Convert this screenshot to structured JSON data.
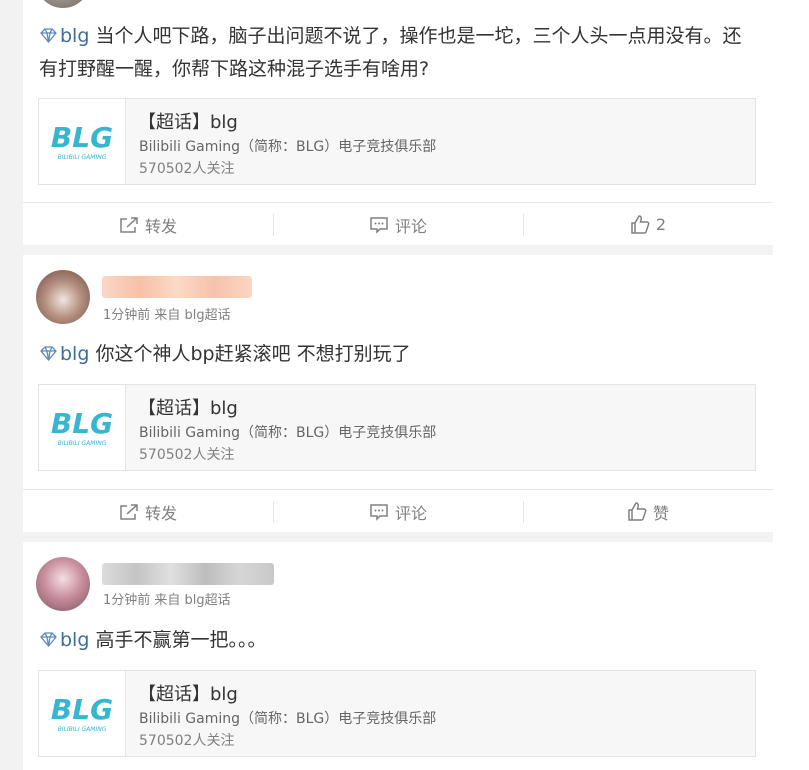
{
  "posts": [
    {
      "text_tag": "blg",
      "text": " 当个人吧下路，脑子出问题不说了，操作也是一坨，三个人头一点用没有。还有打野醒一醒，你帮下路这种混子选手有啥用?",
      "card": {
        "title": "【超话】blg",
        "desc": "Bilibili Gaming（简称：BLG）电子竞技俱乐部",
        "followers": "570502人关注",
        "logo_text": "BLG",
        "logo_sub": "BILIBILI GAMING"
      },
      "actions": {
        "repost": "转发",
        "comment": "评论",
        "like": "2"
      }
    },
    {
      "meta": "1分钟前 来自 blg超话",
      "text_tag": "blg",
      "text": " 你这个神人bp赶紧滚吧 不想打别玩了",
      "card": {
        "title": "【超话】blg",
        "desc": "Bilibili Gaming（简称：BLG）电子竞技俱乐部",
        "followers": "570502人关注",
        "logo_text": "BLG",
        "logo_sub": "BILIBILI GAMING"
      },
      "actions": {
        "repost": "转发",
        "comment": "评论",
        "like": "赞"
      }
    },
    {
      "meta": "1分钟前 来自 blg超话",
      "text_tag": "blg",
      "text": " 高手不赢第一把。。。",
      "card": {
        "title": "【超话】blg",
        "desc": "Bilibili Gaming（简称：BLG）电子竞技俱乐部",
        "followers": "570502人关注",
        "logo_text": "BLG",
        "logo_sub": "BILIBILI GAMING"
      }
    }
  ],
  "colors": {
    "link": "#3f6d9a",
    "logo": "#36b6cf",
    "background": "#f2f2f2"
  },
  "icons": {
    "tag": "diamond-icon",
    "repost": "share-icon",
    "comment": "comment-icon",
    "like": "thumbs-up-icon"
  }
}
